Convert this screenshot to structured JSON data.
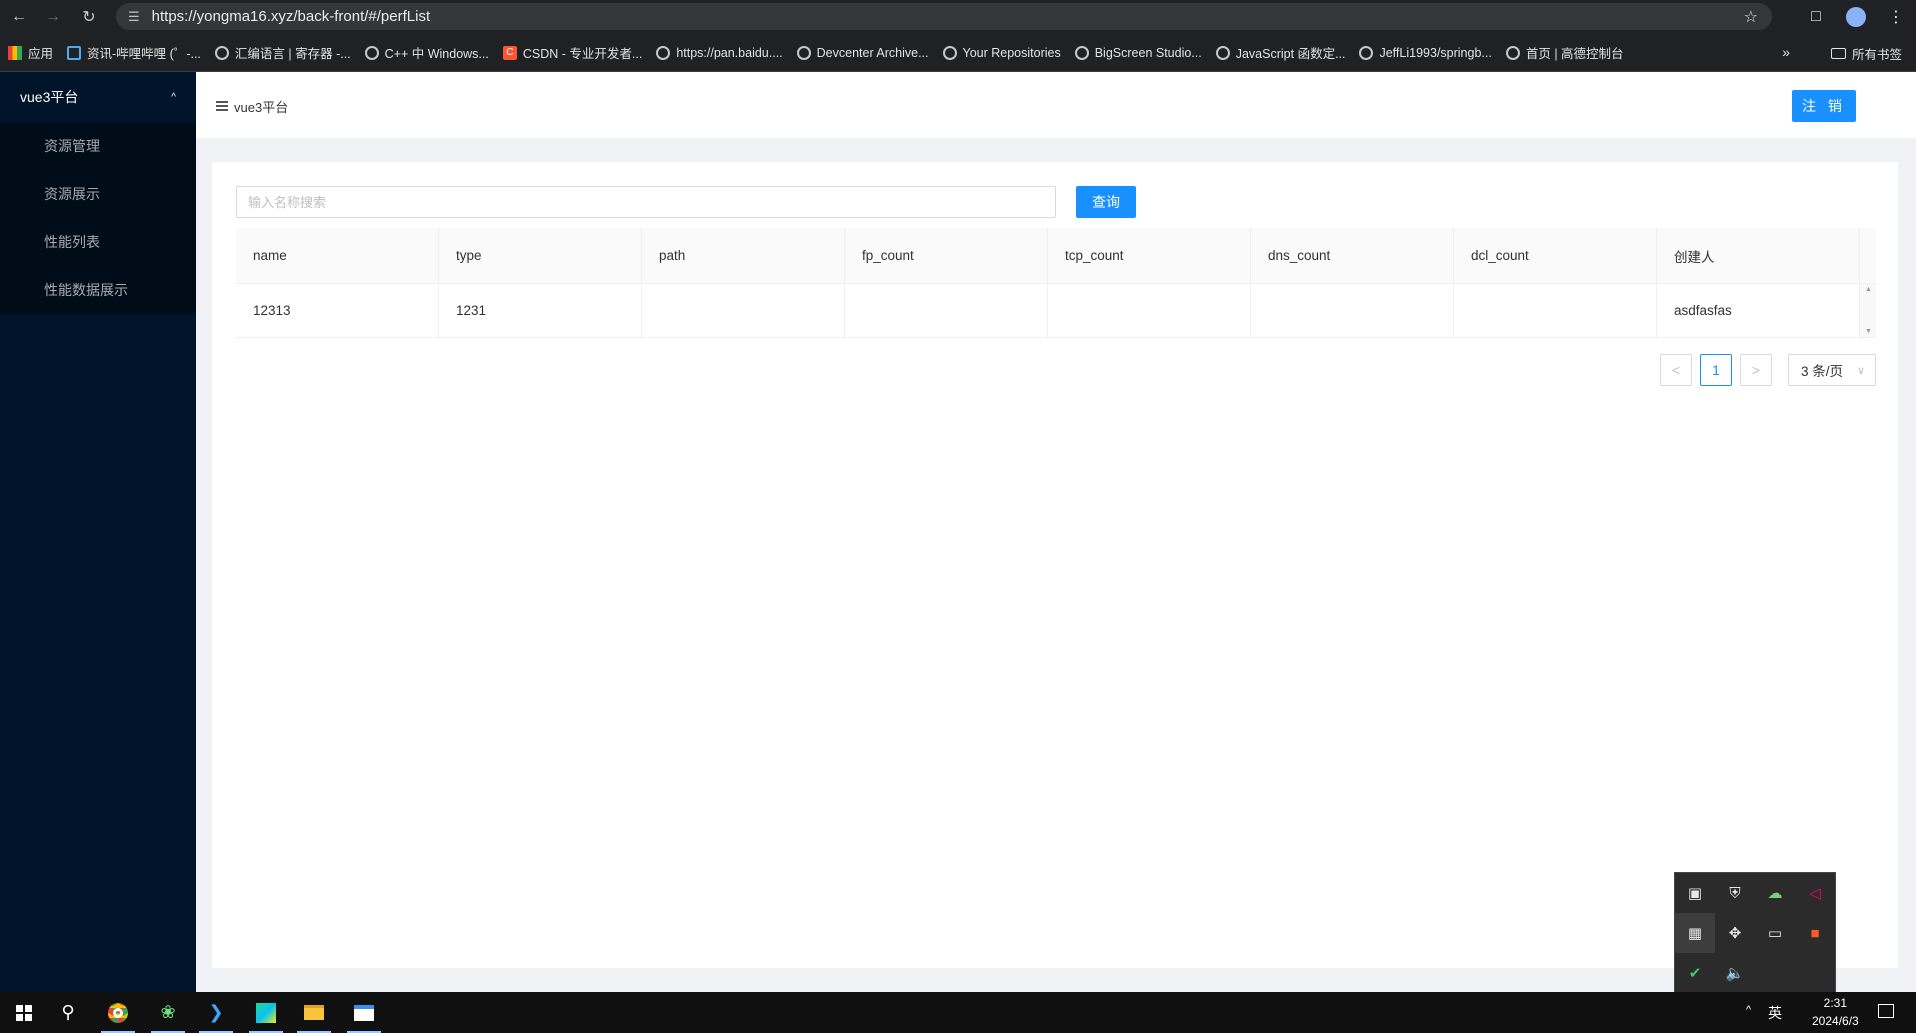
{
  "browser": {
    "url": "https://yongma16.xyz/back-front/#/perfList",
    "bookmarks": [
      {
        "label": "应用",
        "icon": "apps-grid-icon",
        "kind": "apps"
      },
      {
        "label": "资讯-哔哩哔哩 (゜-...",
        "icon": "bilibili-tv-icon",
        "kind": "tv"
      },
      {
        "label": "汇编语言 | 寄存器 -...",
        "icon": "globe-icon",
        "kind": "globe"
      },
      {
        "label": "C++ 中 Windows...",
        "icon": "globe-icon",
        "kind": "globe"
      },
      {
        "label": "CSDN - 专业开发者...",
        "icon": "csdn-icon",
        "kind": "csdn"
      },
      {
        "label": "https://pan.baidu....",
        "icon": "globe-icon",
        "kind": "globe"
      },
      {
        "label": "Devcenter Archive...",
        "icon": "globe-icon",
        "kind": "globe"
      },
      {
        "label": "Your Repositories",
        "icon": "globe-icon",
        "kind": "globe"
      },
      {
        "label": "BigScreen Studio...",
        "icon": "globe-icon",
        "kind": "globe"
      },
      {
        "label": "JavaScript 函数定...",
        "icon": "globe-icon",
        "kind": "globe"
      },
      {
        "label": "JeffLi1993/springb...",
        "icon": "globe-icon",
        "kind": "globe"
      },
      {
        "label": "首页 | 高德控制台",
        "icon": "globe-icon",
        "kind": "globe"
      }
    ],
    "all_bookmarks_label": "所有书签"
  },
  "sidebar": {
    "title": "vue3平台",
    "items": [
      {
        "label": "资源管理"
      },
      {
        "label": "资源展示"
      },
      {
        "label": "性能列表"
      },
      {
        "label": "性能数据展示"
      }
    ]
  },
  "header": {
    "title": "vue3平台",
    "logout_label": "注 销"
  },
  "search": {
    "placeholder": "输入名称搜索",
    "value": "",
    "button_label": "查询"
  },
  "table": {
    "columns": [
      "name",
      "type",
      "path",
      "fp_count",
      "tcp_count",
      "dns_count",
      "dcl_count",
      "创建人"
    ],
    "rows": [
      [
        "12313",
        "1231",
        "",
        "",
        "",
        "",
        "",
        "asdfasfas"
      ]
    ]
  },
  "pagination": {
    "current_page": "1",
    "prev": "<",
    "next": ">",
    "page_size_label": "3 条/页"
  },
  "taskbar": {
    "time": "2:31",
    "date": "2024/6/3",
    "ime": "英"
  }
}
